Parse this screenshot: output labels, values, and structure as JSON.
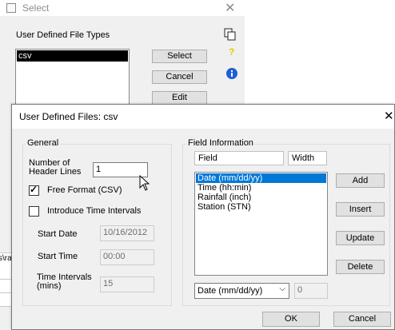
{
  "select_window": {
    "title": "Select",
    "section_label": "User Defined File Types",
    "file_types": [
      "csv"
    ],
    "buttons": {
      "select": "Select",
      "cancel": "Cancel",
      "edit": "Edit"
    },
    "side_strip_fragment": "s\\ra"
  },
  "dialog": {
    "title": "User Defined Files: csv",
    "general": {
      "label": "General",
      "header_lines_label": "Number of\nHeader Lines",
      "header_lines_value": "1",
      "free_format_label": "Free Format (CSV)",
      "free_format_checked": true,
      "time_intervals_label": "Introduce Time Intervals",
      "time_intervals_checked": false,
      "start_date_label": "Start Date",
      "start_date_value": "10/16/2012",
      "start_time_label": "Start Time",
      "start_time_value": "00:00",
      "interval_label": "Time Intervals\n(mins)",
      "interval_value": "15"
    },
    "field_info": {
      "label": "Field Information",
      "col_field": "Field",
      "col_width": "Width",
      "fields": [
        "Date (mm/dd/yy)",
        "Time (hh:min)",
        "Rainfall (inch)",
        "Station (STN)"
      ],
      "selected_index": 0,
      "combo_value": "Date (mm/dd/yy)",
      "width_value": "0",
      "buttons": {
        "add": "Add",
        "insert": "Insert",
        "update": "Update",
        "delete": "Delete"
      }
    },
    "ok_label": "OK",
    "cancel_label": "Cancel"
  },
  "colors": {
    "selection": "#0078d7",
    "help_icon": "#f5d800",
    "info_icon": "#1c5fd6"
  }
}
